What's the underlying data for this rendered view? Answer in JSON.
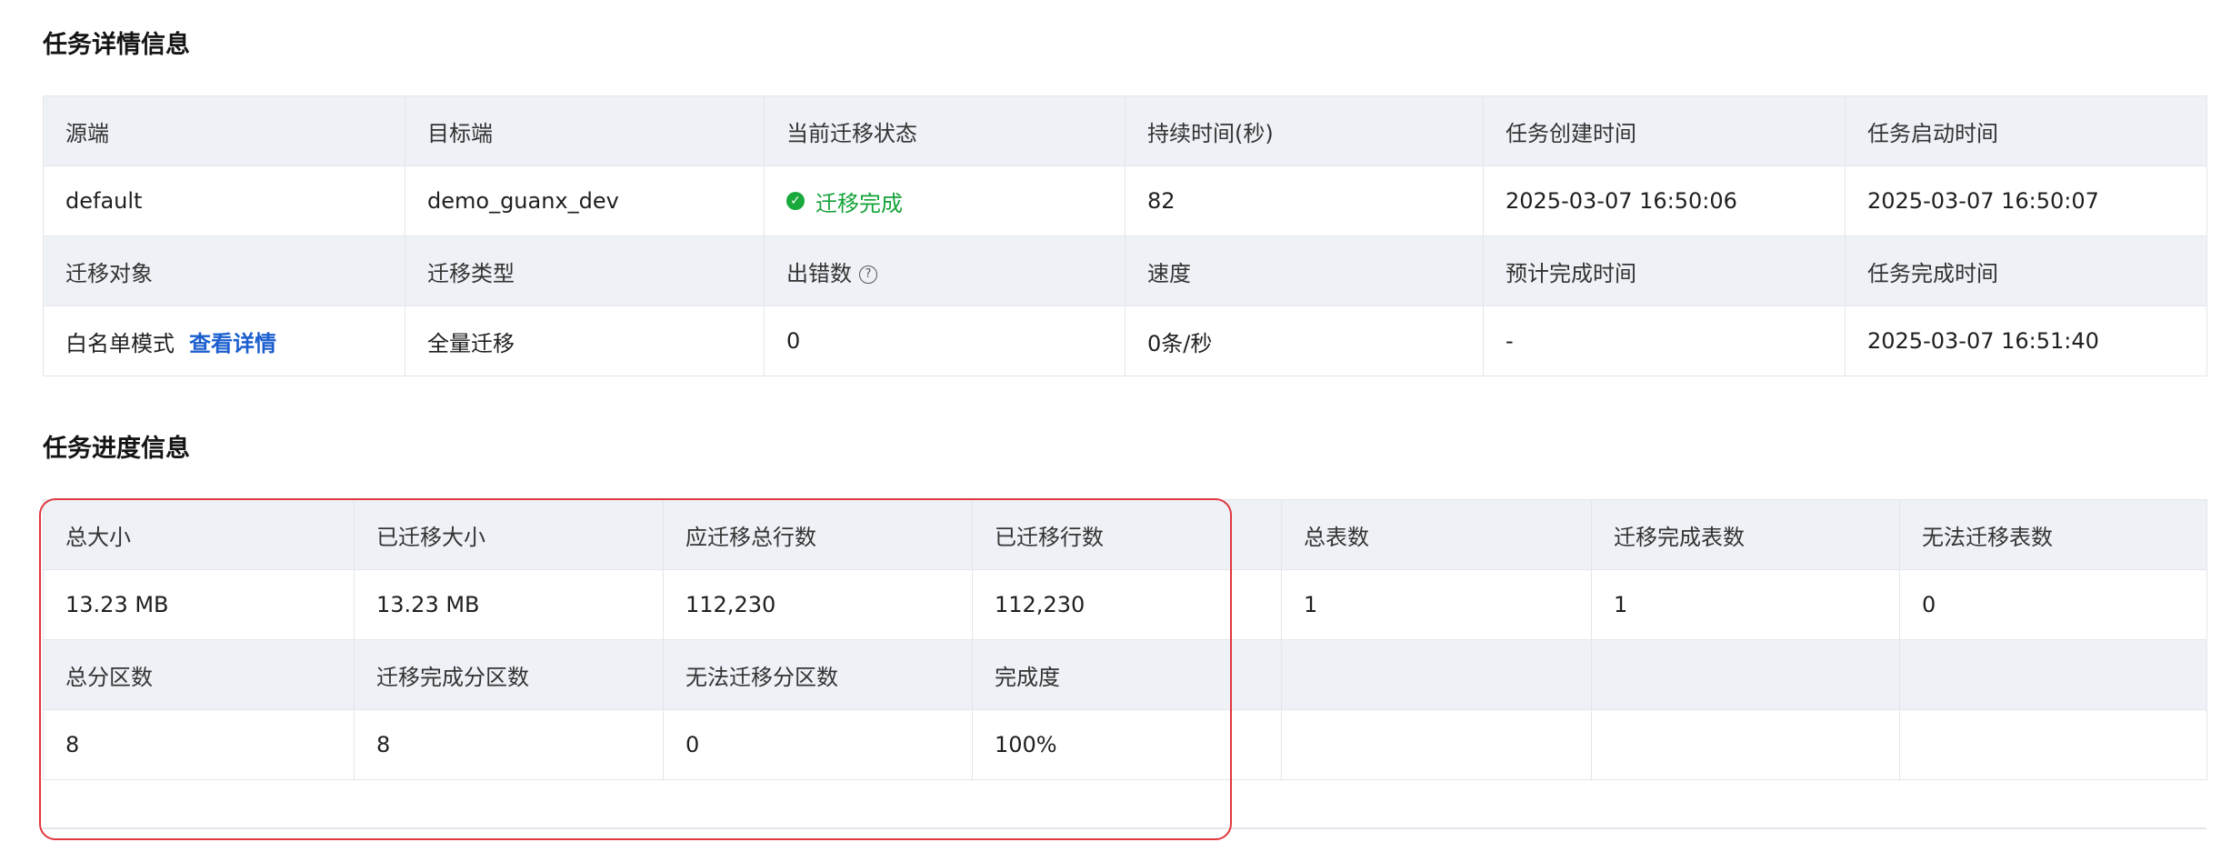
{
  "detail": {
    "title": "任务详情信息",
    "row1_headers": [
      "源端",
      "目标端",
      "当前迁移状态",
      "持续时间(秒)",
      "任务创建时间",
      "任务启动时间"
    ],
    "row1_values": {
      "source": "default",
      "target": "demo_guanx_dev",
      "status": "迁移完成",
      "duration": "82",
      "created": "2025-03-07 16:50:06",
      "started": "2025-03-07 16:50:07"
    },
    "row2_headers": [
      "迁移对象",
      "迁移类型",
      "出错数",
      "速度",
      "预计完成时间",
      "任务完成时间"
    ],
    "row2_values": {
      "object_mode": "白名单模式",
      "object_link": "查看详情",
      "type": "全量迁移",
      "errors": "0",
      "speed": "0条/秒",
      "eta": "-",
      "finished": "2025-03-07 16:51:40"
    }
  },
  "progress": {
    "title": "任务进度信息",
    "row1_headers": [
      "总大小",
      "已迁移大小",
      "应迁移总行数",
      "已迁移行数",
      "总表数",
      "迁移完成表数",
      "无法迁移表数"
    ],
    "row1_values": [
      "13.23 MB",
      "13.23 MB",
      "112,230",
      "112,230",
      "1",
      "1",
      "0"
    ],
    "row2_headers": [
      "总分区数",
      "迁移完成分区数",
      "无法迁移分区数",
      "完成度",
      "",
      "",
      ""
    ],
    "row2_values": [
      "8",
      "8",
      "0",
      "100%",
      "",
      "",
      ""
    ]
  },
  "colors": {
    "header_bg": "#eef1f6",
    "status_green": "#15a33a",
    "link_blue": "#1a5ecf",
    "highlight_red": "#e0383e"
  }
}
